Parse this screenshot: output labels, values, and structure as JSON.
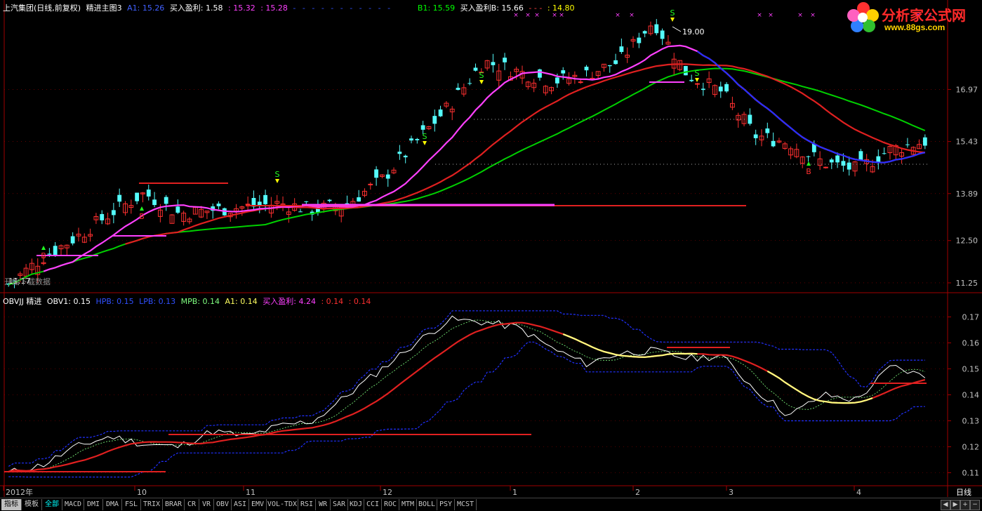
{
  "header": {
    "title": "上汽集团(日线,前复权)",
    "formula": "精进主图3",
    "a1": "A1: 15.26",
    "buy_profit_label": "买入盈利: 1.58",
    "v1": ": 15.32",
    "v2": ": 15.28",
    "b1": "B1: 15.59",
    "buy_profit_b": "买入盈利B: 15.66",
    "v3": ": 14.80"
  },
  "sub_header": {
    "name": "OBVJJ 精进",
    "obv1": "OBV1: 0.15",
    "hpb": "HPB: 0.15",
    "lpb": "LPB: 0.13",
    "mpb": "MPB: 0.14",
    "a1": "A1: 0.14",
    "buy_profit": "买入盈利: 4.24",
    "v1": ": 0.14",
    "v2": ": 0.14"
  },
  "logo": {
    "name": "分析家公式网",
    "url": "www.88gs.com"
  },
  "annotations": {
    "peak_label": "19.00",
    "low_label": "11.17",
    "download_note": "开始下载数据",
    "signal_s": "S",
    "signal_b": "B"
  },
  "price_axis": [
    "16.97",
    "15.43",
    "13.89",
    "12.50",
    "11.25"
  ],
  "obv_axis": [
    "0.17",
    "0.16",
    "0.15",
    "0.14",
    "0.13",
    "0.12",
    "0.11"
  ],
  "time_axis": [
    "2012年",
    "10",
    "11",
    "12",
    "1",
    "2",
    "3",
    "4"
  ],
  "period": "日线",
  "toolbar": {
    "tabs": [
      "指标",
      "模板",
      "全部",
      "MACD",
      "DMI",
      "DMA",
      "FSL",
      "TRIX",
      "BRAR",
      "CR",
      "VR",
      "OBV",
      "ASI",
      "EMV",
      "VOL-TDX",
      "RSI",
      "WR",
      "SAR",
      "KDJ",
      "CCI",
      "ROC",
      "MTM",
      "BOLL",
      "PSY",
      "MCST"
    ]
  },
  "colors": {
    "up": "#ff3030",
    "down": "#54fcfc",
    "ma_green": "#00d000",
    "ma_magenta": "#ff40ff",
    "ma_red": "#e02020",
    "ma_blue": "#2030ff",
    "obv_white": "#ffffff",
    "obv_yellow": "#ffff80",
    "grid_red": "#a00000"
  },
  "chart_data": {
    "type": "candlestick",
    "title": "上汽集团(日线,前复权)",
    "x": [
      "2012-09",
      "2012-10",
      "2012-11",
      "2012-12",
      "2013-01",
      "2013-02",
      "2013-03",
      "2013-04"
    ],
    "price_range": [
      11.0,
      19.2
    ],
    "obv_range": [
      0.105,
      0.175
    ],
    "close_trajectory": [
      11.2,
      12.0,
      12.6,
      13.3,
      13.9,
      13.3,
      13.4,
      13.5,
      13.6,
      13.4,
      13.6,
      14.3,
      15.4,
      16.5,
      17.8,
      17.5,
      17.2,
      17.4,
      17.8,
      19.0,
      17.4,
      16.9,
      15.6,
      15.4,
      14.8,
      14.6,
      15.2,
      15.43
    ],
    "obv_trajectory": [
      0.11,
      0.113,
      0.12,
      0.124,
      0.121,
      0.12,
      0.126,
      0.124,
      0.128,
      0.13,
      0.14,
      0.15,
      0.16,
      0.169,
      0.168,
      0.166,
      0.158,
      0.152,
      0.156,
      0.157,
      0.154,
      0.155,
      0.142,
      0.132,
      0.14,
      0.138,
      0.151,
      0.147
    ]
  }
}
